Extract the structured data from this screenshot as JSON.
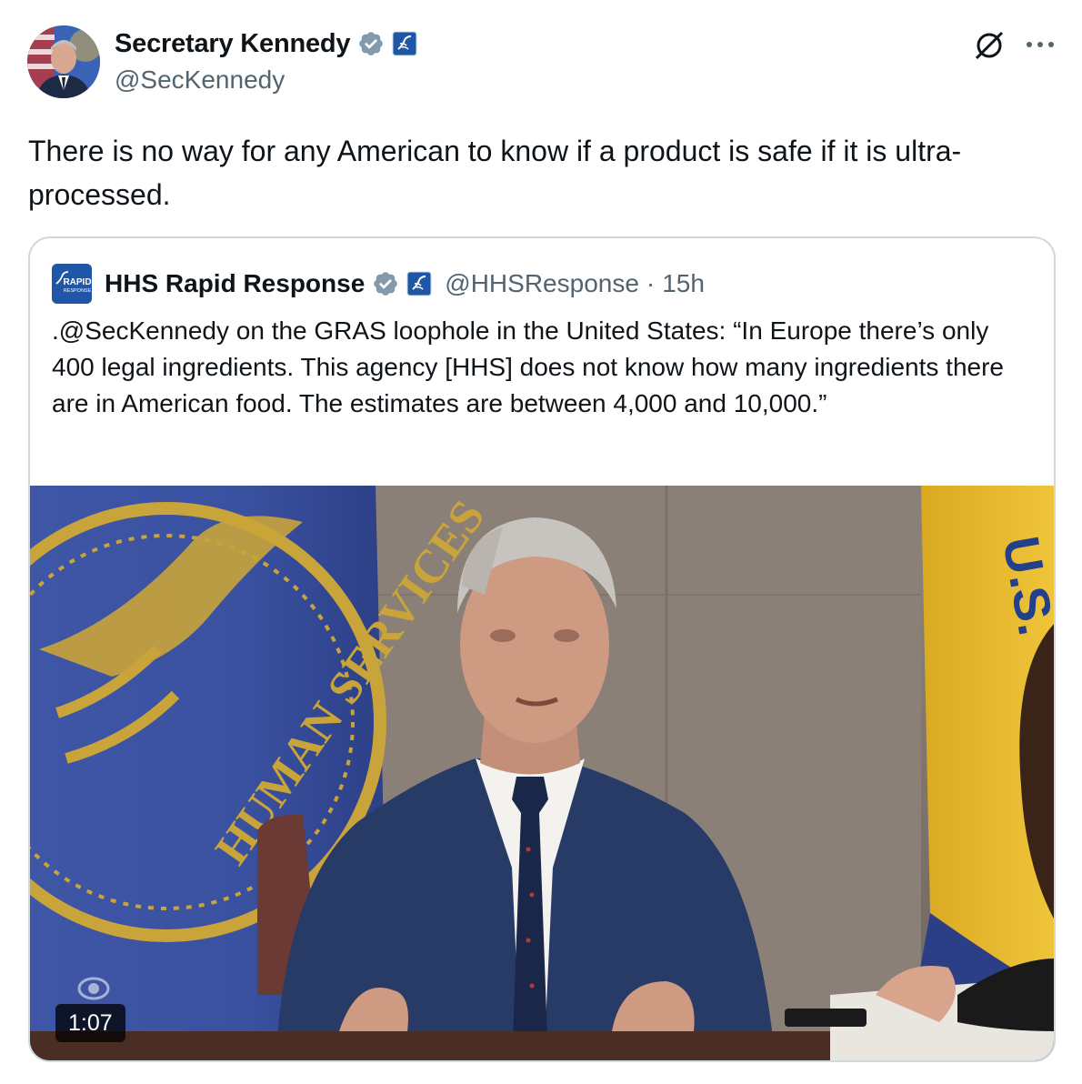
{
  "author": {
    "name": "Secretary Kennedy",
    "handle": "@SecKennedy",
    "verified_color": "#829aab",
    "affiliation_badge": "hhs-logo-icon"
  },
  "tweet": {
    "text": "There is no way for any American to know if a product is safe if it is ultra-processed."
  },
  "actions": {
    "grok_icon": "grok-icon",
    "more_icon": "more-icon"
  },
  "quote": {
    "name": "HHS Rapid Response",
    "handle": "@HHSResponse",
    "separator": "·",
    "time": "15h",
    "avatar_text": "RAPID RESPONSE",
    "text": ".@SecKennedy on the GRAS loophole in the United States: “In Europe there’s only 400 legal ingredients. This agency [HHS] does not know how many ingredients there are in American food. The estimates are between 4,000 and 10,000.”",
    "media": {
      "type": "video",
      "duration": "1:07",
      "flag_text_left": "HUMAN SERVICES",
      "flag_text_right": "U.S."
    }
  },
  "colors": {
    "text_primary": "#0f1419",
    "text_secondary": "#536471",
    "border": "#cfd9de",
    "hhs_blue": "#1f56a8"
  }
}
